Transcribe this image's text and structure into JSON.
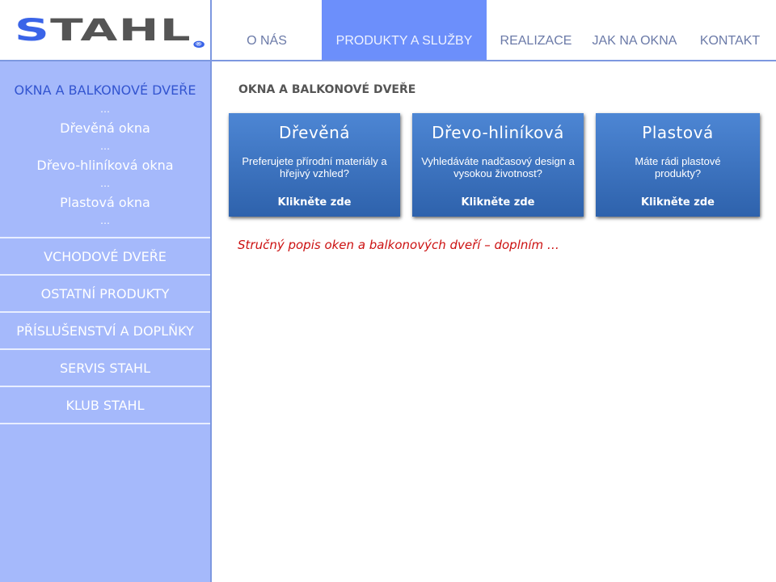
{
  "logo": {
    "text_s": "S",
    "text_rest": "TAHL",
    "registered": "®"
  },
  "colors": {
    "nav_active": "#6c8ffb",
    "sidebar": "#a5b9fb",
    "border": "#7d98e0",
    "card": "#3a70be",
    "desc": "#cc1111"
  },
  "nav": [
    {
      "label": "O NÁS"
    },
    {
      "label": "PRODUKTY A SLUŽBY",
      "active": true
    },
    {
      "label": "REALIZACE"
    },
    {
      "label": "JAK NA OKNA"
    },
    {
      "label": "KONTAKT"
    }
  ],
  "sidebar": {
    "heading": "OKNA A BALKONOVÉ DVEŘE",
    "dots": "…",
    "sub": [
      "Dřevěná okna",
      "Dřevo-hliníková okna",
      "Plastová okna"
    ],
    "items": [
      "VCHODOVÉ DVEŘE",
      "OSTATNÍ PRODUKTY",
      "PŘÍSLUŠENSTVÍ A DOPLŇKY",
      "SERVIS STAHL",
      "KLUB STAHL"
    ]
  },
  "main": {
    "title": "OKNA A BALKONOVÉ DVEŘE",
    "cards": [
      {
        "title": "Dřevěná",
        "text": "Preferujete přírodní materiály a hřejivý vzhled?",
        "link": "Klikněte zde"
      },
      {
        "title": "Dřevo-hliníková",
        "text": "Vyhledáváte nadčasový design a  vysokou životnost?",
        "link": "Klikněte zde"
      },
      {
        "title": "Plastová",
        "text": "Máte rádi plastové produkty?",
        "link": "Klikněte zde"
      }
    ],
    "description": "Stručný popis oken a balkonových dveří – doplním …"
  }
}
